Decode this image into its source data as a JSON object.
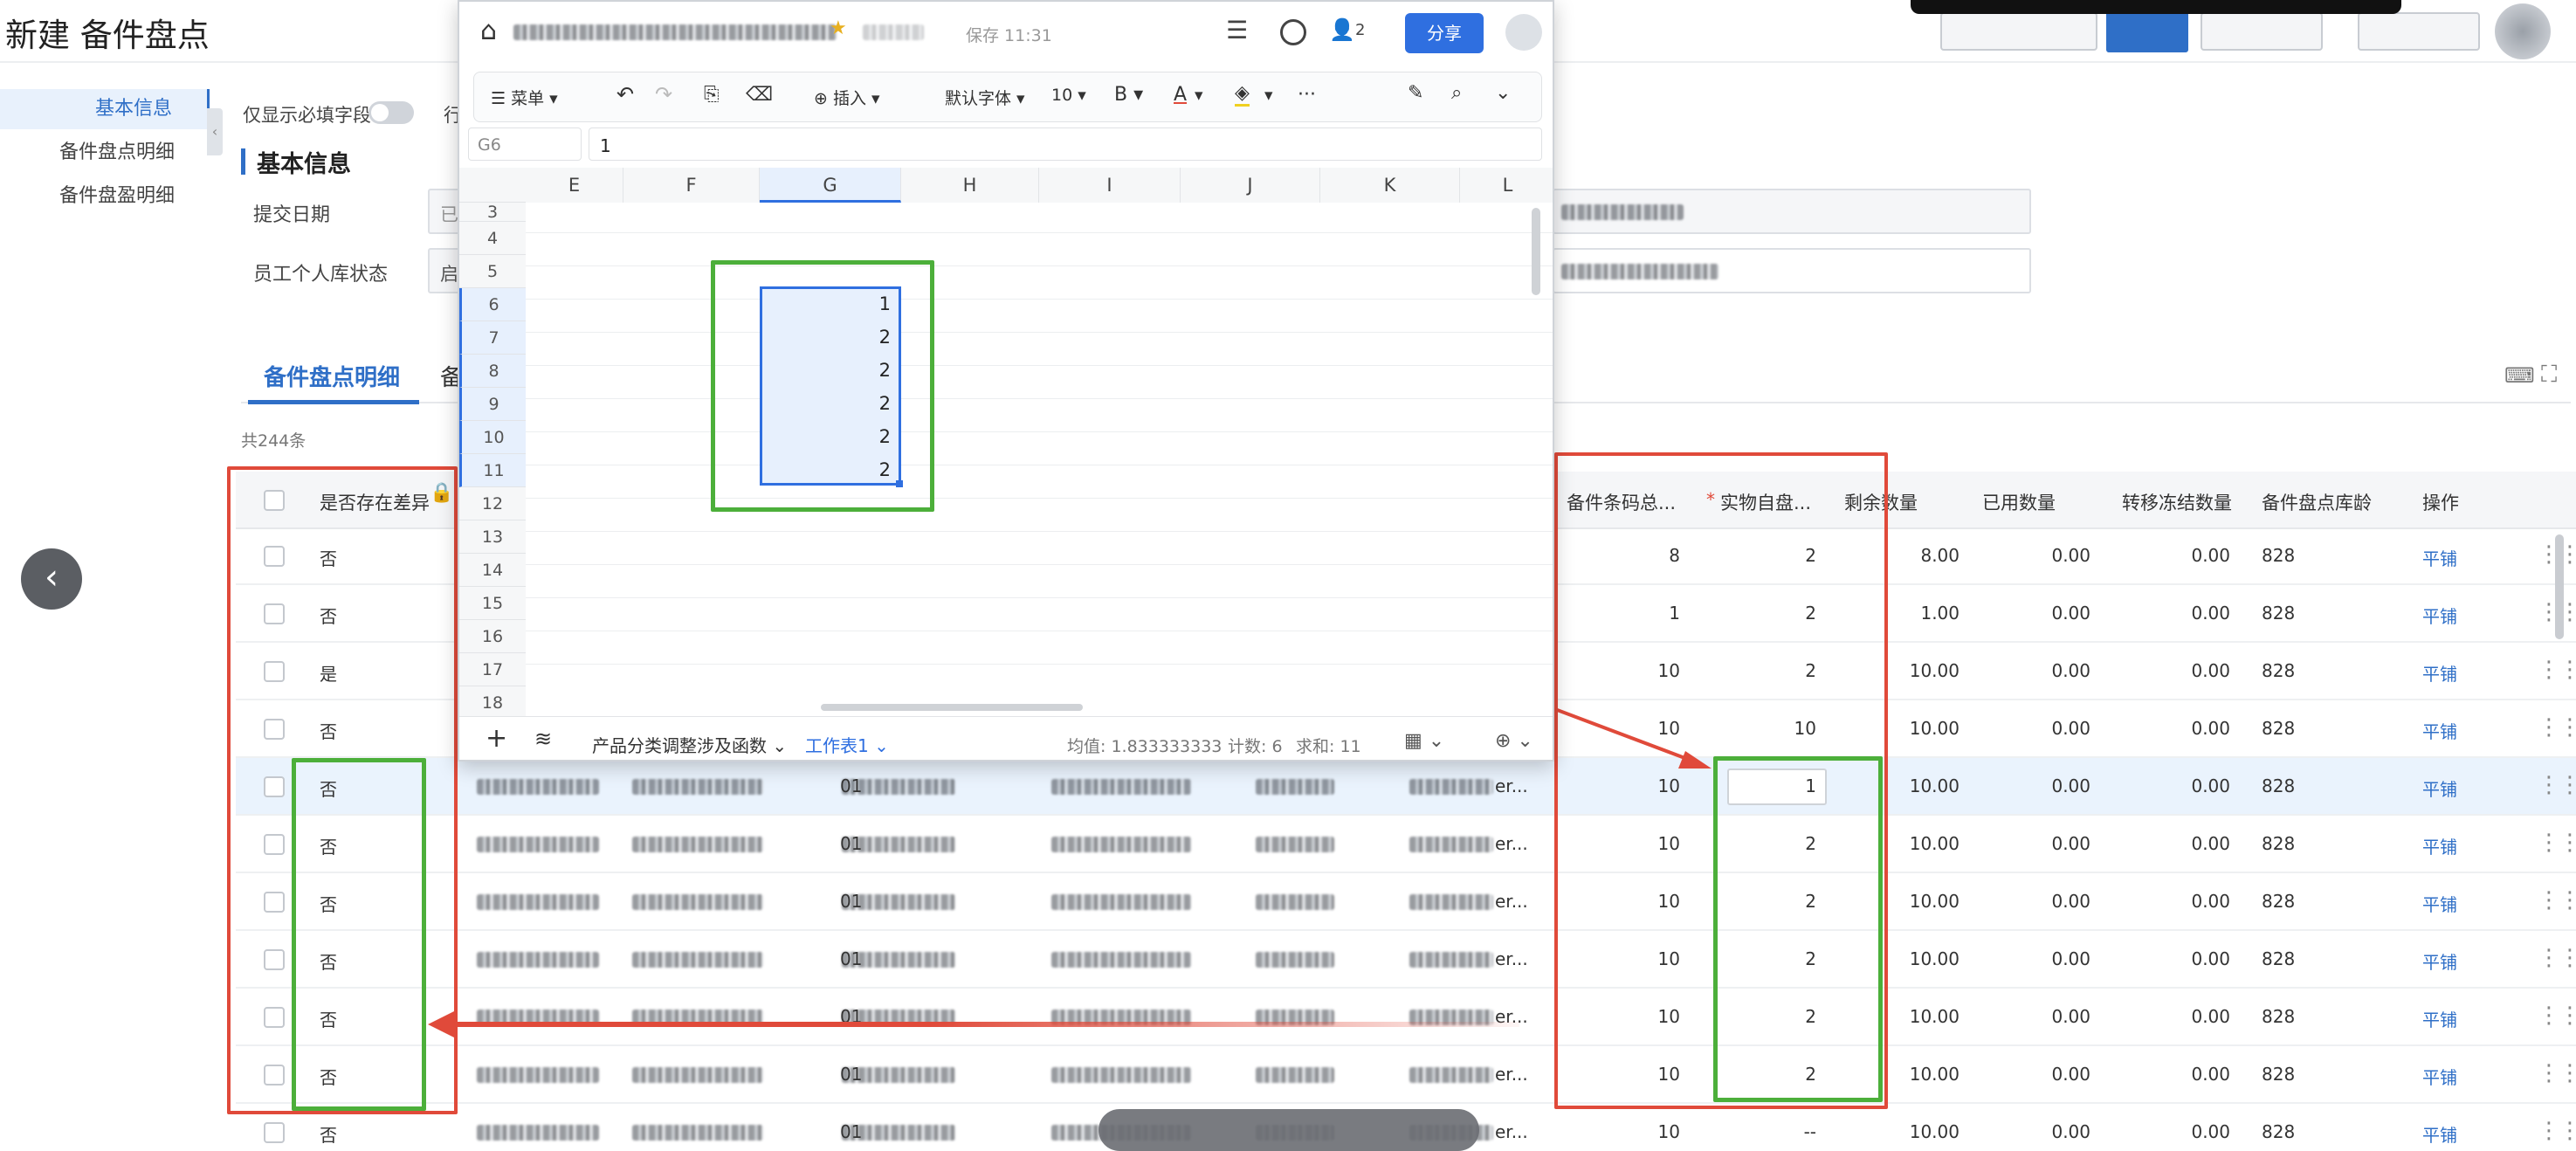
{
  "page": {
    "title": "新建 备件盘点"
  },
  "side_nav": [
    "基本信息",
    "备件盘点明细",
    "备件盘盈明细"
  ],
  "form": {
    "toggle_label": "仅显示必填字段",
    "toggle_label_tail": "行",
    "section_title": "基本信息",
    "fields": [
      {
        "label": "提交日期",
        "value": "已"
      },
      {
        "label": "员工个人库状态",
        "value": "启"
      }
    ]
  },
  "tabs": {
    "active": "备件盘点明细",
    "partial": "备"
  },
  "table": {
    "total": "共244条",
    "headers": {
      "diff": "是否存在差异",
      "barcode_total": "备件条码总...",
      "actual_count": "实物自盘...",
      "remaining": "剩余数量",
      "used": "已用数量",
      "frozen": "转移冻结数量",
      "age": "备件盘点库龄",
      "ops": "操作"
    },
    "rows": [
      {
        "diff": "否",
        "total": "8",
        "actual": "2",
        "remaining": "8.00",
        "used": "0.00",
        "frozen": "0.00",
        "age": "828",
        "op": "平铺",
        "blur": false
      },
      {
        "diff": "否",
        "total": "1",
        "actual": "2",
        "remaining": "1.00",
        "used": "0.00",
        "frozen": "0.00",
        "age": "828",
        "op": "平铺",
        "blur": false
      },
      {
        "diff": "是",
        "total": "10",
        "actual": "2",
        "remaining": "10.00",
        "used": "0.00",
        "frozen": "0.00",
        "age": "828",
        "op": "平铺",
        "blur": false
      },
      {
        "diff": "否",
        "total": "10",
        "actual": "10",
        "remaining": "10.00",
        "used": "0.00",
        "frozen": "0.00",
        "age": "828",
        "op": "平铺",
        "blur": false
      },
      {
        "diff": "否",
        "total": "10",
        "actual": "1",
        "remaining": "10.00",
        "used": "0.00",
        "frozen": "0.00",
        "age": "828",
        "op": "平铺",
        "blur": true,
        "editing": true
      },
      {
        "diff": "否",
        "total": "10",
        "actual": "2",
        "remaining": "10.00",
        "used": "0.00",
        "frozen": "0.00",
        "age": "828",
        "op": "平铺",
        "blur": true
      },
      {
        "diff": "否",
        "total": "10",
        "actual": "2",
        "remaining": "10.00",
        "used": "0.00",
        "frozen": "0.00",
        "age": "828",
        "op": "平铺",
        "blur": true
      },
      {
        "diff": "否",
        "total": "10",
        "actual": "2",
        "remaining": "10.00",
        "used": "0.00",
        "frozen": "0.00",
        "age": "828",
        "op": "平铺",
        "blur": true
      },
      {
        "diff": "否",
        "total": "10",
        "actual": "2",
        "remaining": "10.00",
        "used": "0.00",
        "frozen": "0.00",
        "age": "828",
        "op": "平铺",
        "blur": true
      },
      {
        "diff": "否",
        "total": "10",
        "actual": "2",
        "remaining": "10.00",
        "used": "0.00",
        "frozen": "0.00",
        "age": "828",
        "op": "平铺",
        "blur": true
      },
      {
        "diff": "否",
        "total": "10",
        "actual": "--",
        "remaining": "10.00",
        "used": "0.00",
        "frozen": "0.00",
        "age": "828",
        "op": "平铺",
        "blur": true
      }
    ],
    "blur_col_texts": [
      "01",
      "er..."
    ]
  },
  "sheet": {
    "saved": "保存 11:31",
    "share": "分享",
    "collab_count": "2",
    "toolbar": {
      "menu": "菜单",
      "insert": "插入",
      "font": "默认字体",
      "size": "10",
      "bold": "B",
      "fontcolor": "A",
      "more": "···"
    },
    "cell_ref": "G6",
    "formula_value": "1",
    "columns": [
      "E",
      "F",
      "G",
      "H",
      "I",
      "J",
      "K",
      "L"
    ],
    "row_numbers": [
      "3",
      "4",
      "5",
      "6",
      "7",
      "8",
      "9",
      "10",
      "11",
      "12",
      "13",
      "14",
      "15",
      "16",
      "17",
      "18"
    ],
    "g_values": [
      "1",
      "2",
      "2",
      "2",
      "2",
      "2"
    ],
    "tabs": [
      "产品分类调整涉及函数",
      "工作表1"
    ],
    "status": {
      "avg": "均值: 1.833333333",
      "count": "计数: 6",
      "sum": "求和: 11"
    }
  },
  "colors": {
    "accent": "#2f6fc7",
    "red_annotation": "#e04a3a",
    "green_annotation": "#4caf3a"
  }
}
